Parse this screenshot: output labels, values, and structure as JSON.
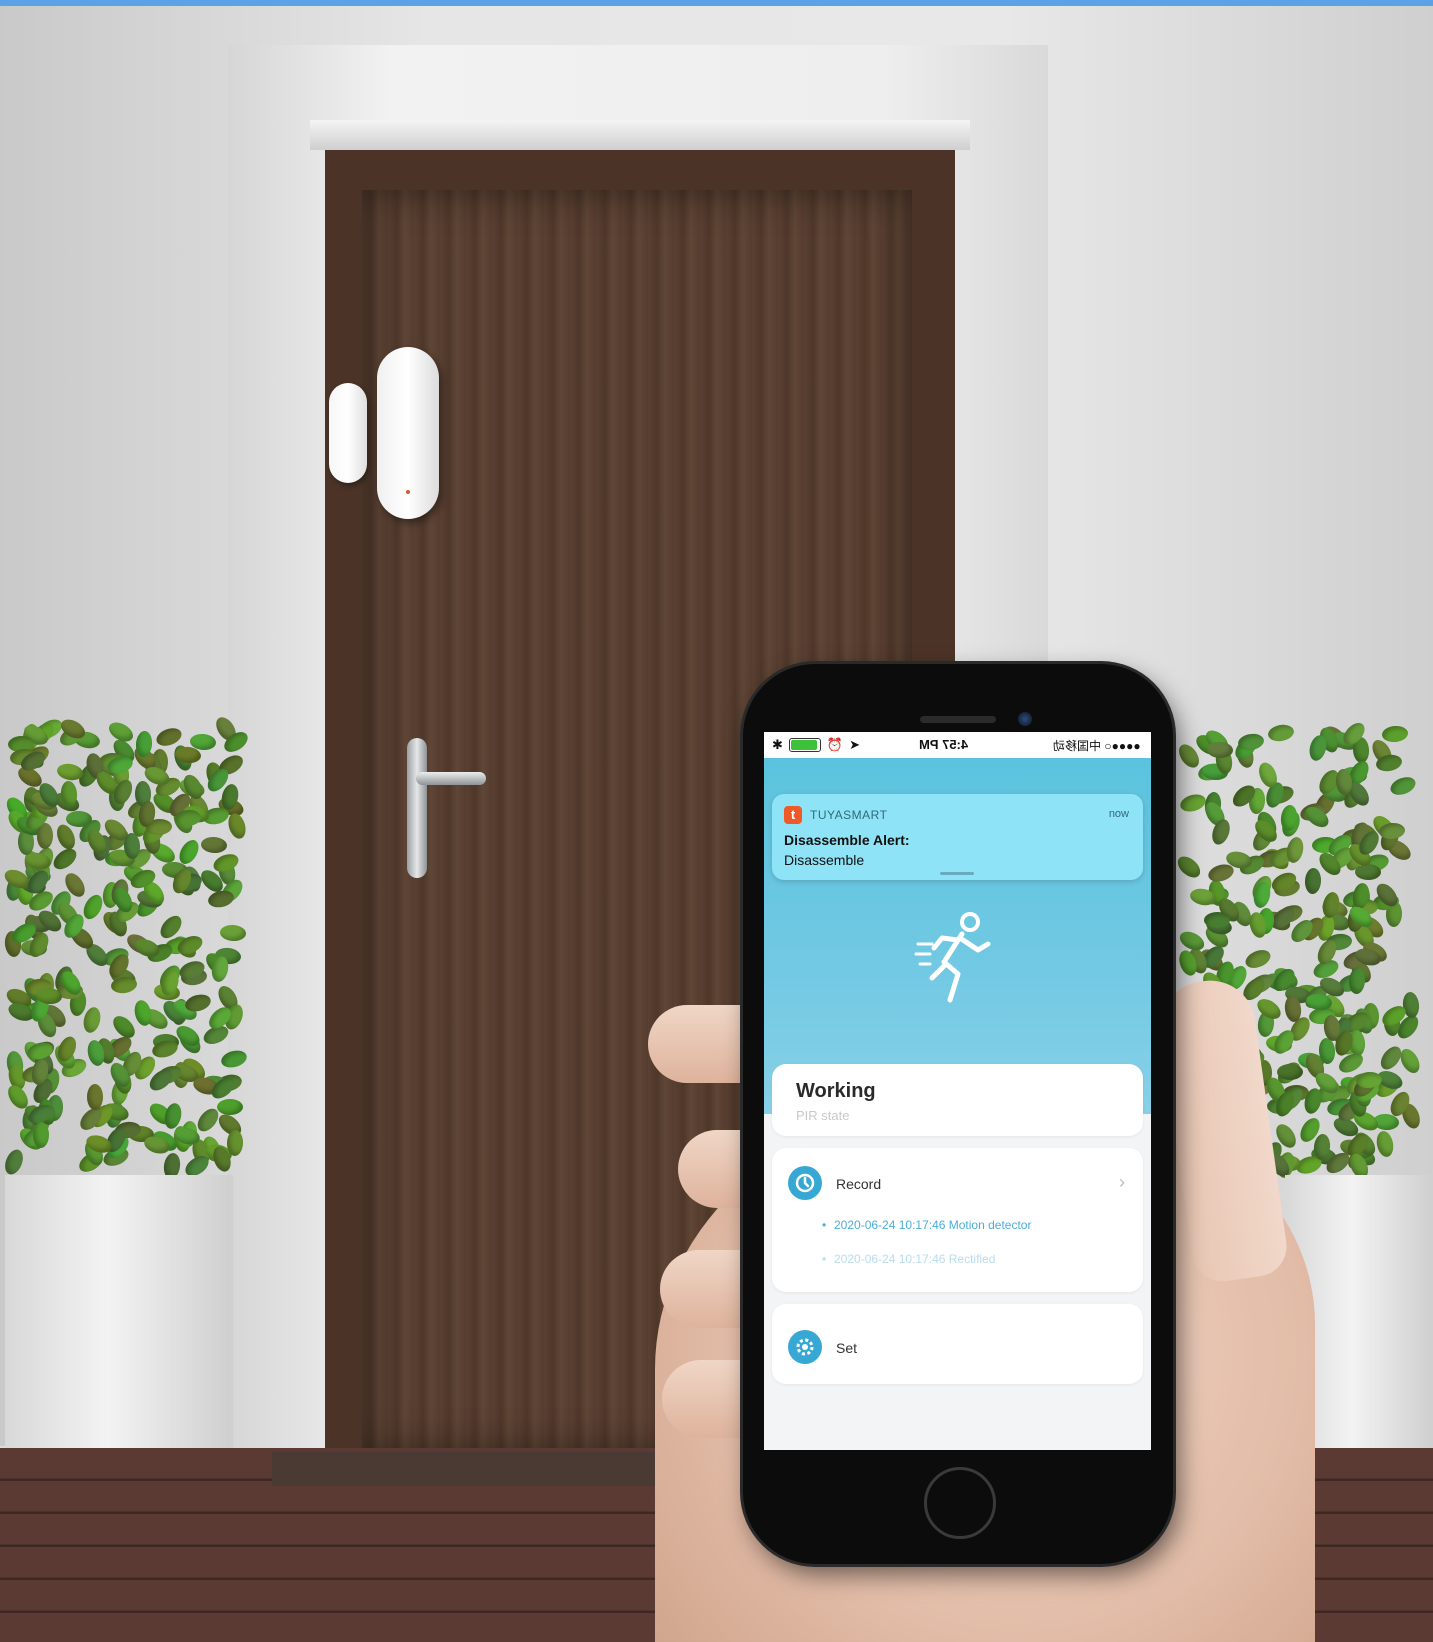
{
  "phone": {
    "status_bar": {
      "time": "4:57 PM",
      "carrier": "●●●●○ 中国移动",
      "left_icons": [
        "battery-icon",
        "bluetooth-icon",
        "location-icon",
        "alarm-icon"
      ]
    },
    "notification": {
      "app_name": "TUYASMART",
      "app_icon_letter": "t",
      "time": "now",
      "title": "Disassemble Alert:",
      "body": "Disassemble"
    },
    "hero": {
      "icon": "running-person-icon",
      "background_color": "#5bc3de"
    },
    "status_card": {
      "title": "Working",
      "subtitle": "PIR state"
    },
    "record_card": {
      "label": "Record",
      "icon": "clock-icon",
      "entries": [
        "2020-06-24 10:17:46 Motion detector",
        "2020-06-24 10:17:46 Rectified"
      ]
    },
    "settings_row": {
      "label": "Set",
      "icon": "gear-icon"
    }
  },
  "colors": {
    "accent": "#37a8d4",
    "notification_bg": "#8fe3f6",
    "brand_icon": "#f05a28",
    "top_bar": "#5aa3e6"
  }
}
